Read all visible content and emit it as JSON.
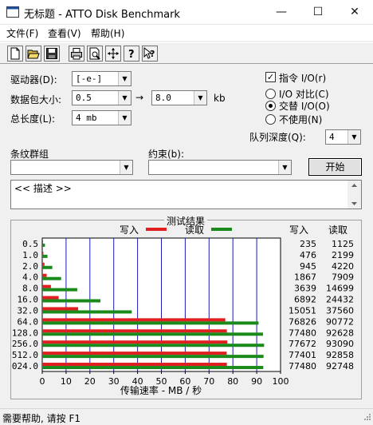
{
  "window": {
    "title": "无标题 - ATTO Disk Benchmark",
    "minimize": "—",
    "maximize": "☐",
    "close": "✕"
  },
  "menu": {
    "file": "文件(F)",
    "view": "查看(V)",
    "help": "帮助(H)"
  },
  "toolbar": {
    "icons": [
      "new-document-icon",
      "open-folder-icon",
      "save-disk-icon",
      "print-icon",
      "print-preview-icon",
      "move-icon",
      "help-icon",
      "context-help-icon"
    ]
  },
  "form": {
    "drive_label": "驱动器(D):",
    "drive_value": "[-e-]",
    "transfer_size_label": "数据包大小:",
    "transfer_from": "0.5",
    "transfer_arrow": "→",
    "transfer_to": "8.0",
    "transfer_unit": "kb",
    "length_label": "总长度(L):",
    "length_value": "4 mb",
    "direct_io_label": "指令 I/O(r)",
    "direct_io_checked": true,
    "io_options": [
      {
        "label": "I/O 对比(C)",
        "selected": false
      },
      {
        "label": "交替 I/O(O)",
        "selected": true
      },
      {
        "label": "不使用(N)",
        "selected": false
      }
    ],
    "queue_depth_label": "队列深度(Q):",
    "queue_depth_value": "4",
    "stripe_group_label": "条纹群组",
    "stripe_group_value": "",
    "constraint_label": "约束(b):",
    "constraint_value": "",
    "start_button": "开始",
    "description": "<< 描述 >>"
  },
  "results": {
    "title": "测试结果",
    "write_header": "写入",
    "read_header": "读取"
  },
  "chart_data": {
    "type": "bar",
    "orientation": "horizontal",
    "legend": [
      {
        "name": "写入",
        "color": "#e02020"
      },
      {
        "name": "读取",
        "color": "#1a8a1a"
      }
    ],
    "categories": [
      "0.5",
      "1.0",
      "2.0",
      "4.0",
      "8.0",
      "16.0",
      "32.0",
      "64.0",
      "128.0",
      "256.0",
      "512.0",
      "024.0"
    ],
    "series": [
      {
        "name": "写入",
        "color": "#e02020",
        "values": [
          235,
          476,
          945,
          1867,
          3639,
          6892,
          15051,
          76826,
          77480,
          77672,
          77401,
          77480
        ]
      },
      {
        "name": "读取",
        "color": "#1a8a1a",
        "values": [
          1125,
          2199,
          4220,
          7909,
          14699,
          24432,
          37560,
          90772,
          92628,
          93090,
          92858,
          92748
        ]
      }
    ],
    "write_labels": [
      "235",
      "476",
      "945",
      "1867",
      "3639",
      "6892",
      "15051",
      "76826",
      "77480",
      "77672",
      "77401",
      "77480"
    ],
    "read_labels": [
      "1125",
      "2199",
      "4220",
      "7909",
      "14699",
      "24432",
      "37560",
      "90772",
      "92628",
      "93090",
      "92858",
      "92748"
    ],
    "value_unit_divisor": 1000,
    "xlim": [
      0,
      100
    ],
    "xticks": [
      "0",
      "10",
      "20",
      "30",
      "40",
      "50",
      "60",
      "70",
      "80",
      "90",
      "100"
    ],
    "xlabel": "传输速率 - MB / 秒",
    "grid": true
  },
  "status": {
    "text": "需要帮助, 请按 F1"
  }
}
